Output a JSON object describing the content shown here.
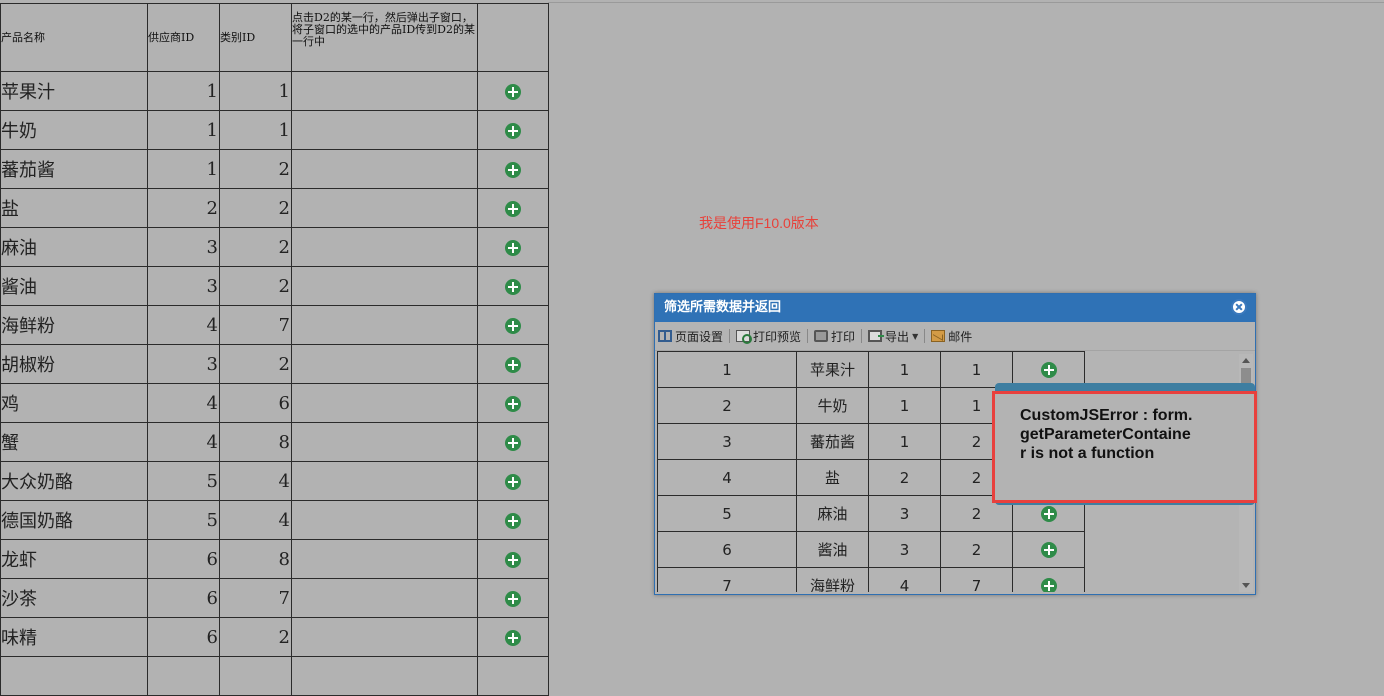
{
  "main_table": {
    "headers": [
      "产品名称",
      "供应商ID",
      "类别ID",
      "点击D2的某一行，然后弹出子窗口，将子窗口的选中的产品ID传到D2的某一行中",
      ""
    ],
    "rows": [
      {
        "name": "苹果汁",
        "supplier": "1",
        "category": "1"
      },
      {
        "name": "牛奶",
        "supplier": "1",
        "category": "1"
      },
      {
        "name": "蕃茄酱",
        "supplier": "1",
        "category": "2"
      },
      {
        "name": "盐",
        "supplier": "2",
        "category": "2"
      },
      {
        "name": "麻油",
        "supplier": "3",
        "category": "2"
      },
      {
        "name": "酱油",
        "supplier": "3",
        "category": "2"
      },
      {
        "name": "海鲜粉",
        "supplier": "4",
        "category": "7"
      },
      {
        "name": "胡椒粉",
        "supplier": "3",
        "category": "2"
      },
      {
        "name": "鸡",
        "supplier": "4",
        "category": "6"
      },
      {
        "name": "蟹",
        "supplier": "4",
        "category": "8"
      },
      {
        "name": "大众奶酪",
        "supplier": "5",
        "category": "4"
      },
      {
        "name": "德国奶酪",
        "supplier": "5",
        "category": "4"
      },
      {
        "name": "龙虾",
        "supplier": "6",
        "category": "8"
      },
      {
        "name": "沙茶",
        "supplier": "6",
        "category": "7"
      },
      {
        "name": "味精",
        "supplier": "6",
        "category": "2"
      }
    ]
  },
  "note": "我是使用F10.0版本",
  "dialog": {
    "title": "筛选所需数据并返回",
    "toolbar": {
      "page_setup": "页面设置",
      "print_preview": "打印预览",
      "print": "打印",
      "export": "导出",
      "email": "邮件"
    },
    "rows": [
      {
        "id": "1",
        "name": "苹果汁",
        "supplier": "1",
        "category": "1"
      },
      {
        "id": "2",
        "name": "牛奶",
        "supplier": "1",
        "category": "1"
      },
      {
        "id": "3",
        "name": "蕃茄酱",
        "supplier": "1",
        "category": "2"
      },
      {
        "id": "4",
        "name": "盐",
        "supplier": "2",
        "category": "2"
      },
      {
        "id": "5",
        "name": "麻油",
        "supplier": "3",
        "category": "2"
      },
      {
        "id": "6",
        "name": "酱油",
        "supplier": "3",
        "category": "2"
      },
      {
        "id": "7",
        "name": "海鲜粉",
        "supplier": "4",
        "category": "7"
      }
    ]
  },
  "error": {
    "message": "CustomJSError : form.getParameterContainer is not a function"
  },
  "colors": {
    "accent": "#2f72b6",
    "add_icon": "#2e8b48",
    "note_text": "#e8413a",
    "error_border": "#e8403d"
  }
}
